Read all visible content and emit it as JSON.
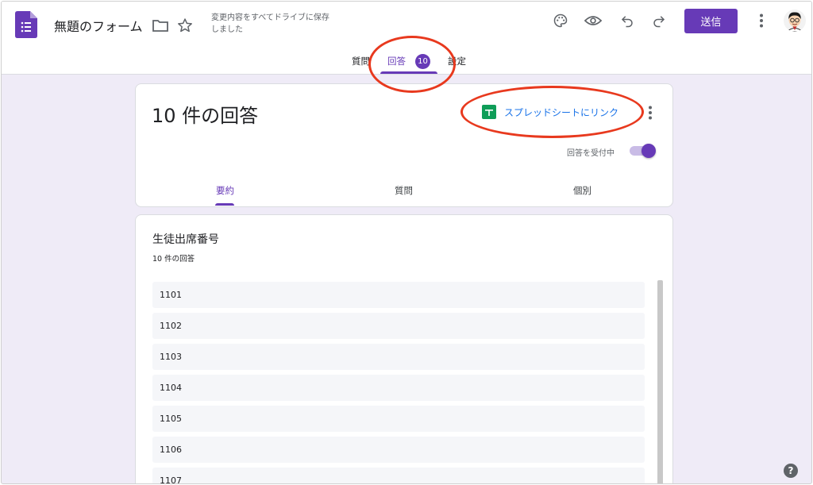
{
  "header": {
    "form_title": "無題のフォーム",
    "save_status": "変更内容をすべてドライブに保存しました",
    "send_label": "送信",
    "icons": [
      "forms-logo-icon",
      "folder-icon",
      "star-icon",
      "palette-icon",
      "eye-icon",
      "undo-icon",
      "redo-icon",
      "more-vert-icon",
      "user-avatar"
    ]
  },
  "top_tabs": {
    "questions": "質問",
    "answers": "回答",
    "answers_badge": "10",
    "settings": "設定"
  },
  "summary_card": {
    "response_count": "10 件の回答",
    "sheets_link": "スプレッドシートにリンク",
    "accepting_label": "回答を受付中",
    "accepting": true,
    "tabs": [
      "要約",
      "質問",
      "個別"
    ]
  },
  "question_card": {
    "title": "生徒出席番号",
    "count": "10 件の回答",
    "responses": [
      "1101",
      "1102",
      "1103",
      "1104",
      "1105",
      "1106",
      "1107"
    ]
  },
  "colors": {
    "accent": "#673ab7",
    "background": "#efebf7",
    "link": "#1a73e8",
    "annotation": "#e8391e"
  }
}
